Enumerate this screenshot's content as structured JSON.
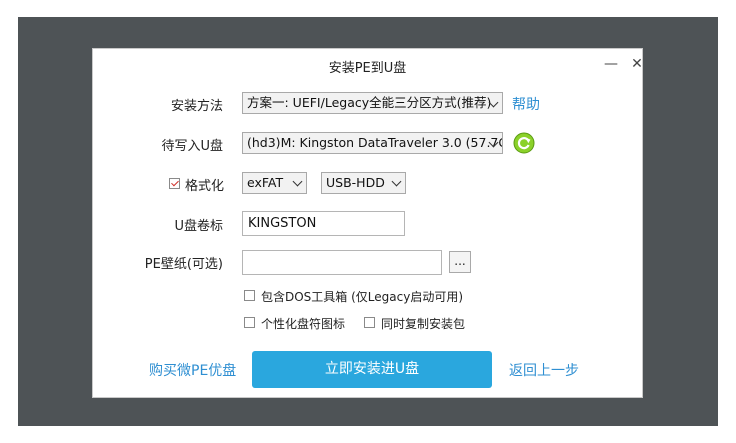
{
  "window": {
    "title": "安装PE到U盘"
  },
  "controls": {
    "minimize": "—",
    "close": "✕"
  },
  "form": {
    "install_method": {
      "label": "安装方法",
      "value": "方案一:  UEFI/Legacy全能三分区方式(推荐)"
    },
    "help_link": "帮助",
    "target_disk": {
      "label": "待写入U盘",
      "value": "(hd3)M: Kingston DataTraveler 3.0 (57.7G"
    },
    "format": {
      "label": "格式化",
      "checked": true,
      "fs": "exFAT",
      "mode": "USB-HDD"
    },
    "volume_label": {
      "label": "U盘卷标",
      "value": "KINGSTON"
    },
    "wallpaper": {
      "label": "PE壁纸(可选)",
      "value": "",
      "browse": "..."
    },
    "options": {
      "dos_tools": {
        "label": "包含DOS工具箱 (仅Legacy启动可用)",
        "checked": false
      },
      "custom_icon": {
        "label": "个性化盘符图标",
        "checked": false
      },
      "copy_installer": {
        "label": "同时复制安装包",
        "checked": false
      }
    }
  },
  "footer": {
    "buy_link": "购买微PE优盘",
    "install_button": "立即安装进U盘",
    "back_link": "返回上一步"
  },
  "icons": {
    "refresh": "refresh-icon"
  },
  "colors": {
    "accent": "#2aa7de",
    "link": "#2f8fd2",
    "refresh": "#7cc81f",
    "check": "#d0302a"
  }
}
